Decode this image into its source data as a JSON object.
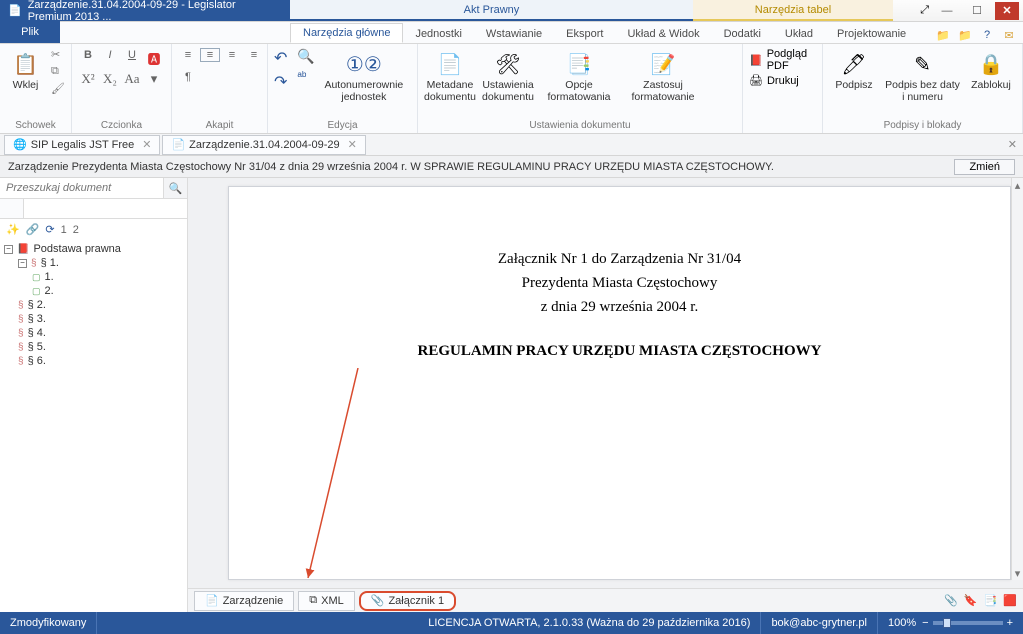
{
  "titlebar": {
    "left": "Zarządzenie.31.04.2004-09-29 - Legislator Premium 2013 ...",
    "center": "Akt Prawny",
    "table_tools": "Narzędzia tabel"
  },
  "file_tab": "Plik",
  "ribbon_tabs": {
    "main": "Narzędzia główne",
    "units": "Jednostki",
    "insert": "Wstawianie",
    "export": "Eksport",
    "layout_view": "Układ & Widok",
    "addons": "Dodatki",
    "layout": "Układ",
    "design": "Projektowanie"
  },
  "groups": {
    "clipboard": {
      "paste": "Wklej",
      "label": "Schowek"
    },
    "font": {
      "label": "Czcionka"
    },
    "paragraph": {
      "label": "Akapit"
    },
    "edit": {
      "autonum": "Autonumerownie jednostek",
      "label": "Edycja"
    },
    "docsettings": {
      "metadata": "Metadane dokumentu",
      "settings": "Ustawienia dokumentu",
      "formatops": "Opcje formatowania",
      "applyfmt": "Zastosuj formatowanie",
      "label": "Ustawienia dokumentu"
    },
    "output": {
      "preview": "Podgląd PDF",
      "print": "Drukuj"
    },
    "sign": {
      "sign": "Podpisz",
      "sign_nodate": "Podpis bez daty i numeru",
      "lock": "Zablokuj",
      "label": "Podpisy i blokady"
    }
  },
  "doc_tabs": {
    "tab1": "SIP Legalis JST Free",
    "tab2": "Zarządzenie.31.04.2004-09-29"
  },
  "info_bar": {
    "text": "Zarządzenie Prezydenta Miasta Częstochowy Nr 31/04 z dnia 29 września 2004 r. W SPRAWIE REGULAMINU PRACY URZĘDU MIASTA CZĘSTOCHOWY.",
    "change_btn": "Zmień"
  },
  "search_placeholder": "Przeszukaj dokument",
  "nav_numbers": {
    "one": "1",
    "two": "2"
  },
  "tree": {
    "root": "Podstawa prawna",
    "s1": "§ 1.",
    "s1_1": "1.",
    "s1_2": "2.",
    "s2": "§ 2.",
    "s3": "§ 3.",
    "s4": "§ 4.",
    "s5": "§ 5.",
    "s6": "§ 6."
  },
  "document": {
    "h1": "Załącznik Nr 1 do Zarządzenia Nr 31/04",
    "h2": "Prezydenta Miasta Częstochowy",
    "h3": "z dnia 29 września 2004 r.",
    "title": "REGULAMIN PRACY URZĘDU MIASTA CZĘSTOCHOWY"
  },
  "bottom_tabs": {
    "zarz": "Zarządzenie",
    "xml": "XML",
    "zal1": "Załącznik 1"
  },
  "status": {
    "modified": "Zmodyfikowany",
    "license": "LICENCJA OTWARTA, 2.1.0.33 (Ważna do 29 października 2016)",
    "email": "bok@abc-grytner.pl",
    "zoom": "100%"
  }
}
